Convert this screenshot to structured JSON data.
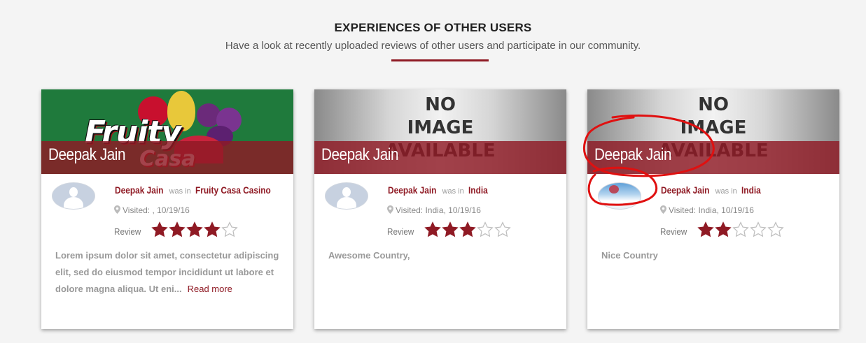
{
  "section": {
    "title": "EXPERIENCES OF OTHER USERS",
    "subtitle": "Have a look at recently uploaded reviews of other users and participate in our community."
  },
  "accent_color": "#8f1a24",
  "cards": [
    {
      "image_type": "fruity-casa-logo",
      "image_text": "Fruity Casa",
      "overlay_name": "Deepak Jain",
      "user_name": "Deepak Jain",
      "was_in": "was in",
      "place": "Fruity Casa Casino",
      "visited": "Visited: , 10/19/16",
      "review_label": "Review",
      "rating": 4,
      "rating_max": 5,
      "description": "Lorem ipsum dolor sit amet, consectetur adipiscing elit, sed do eiusmod tempor incididunt ut labore et dolore magna aliqua. Ut eni...",
      "read_more": "Read more",
      "avatar": "placeholder-person-icon"
    },
    {
      "image_type": "no-image",
      "image_text": "NO\nIMAGE\nAVAILABLE",
      "overlay_name": "Deepak Jain",
      "user_name": "Deepak Jain",
      "was_in": "was in",
      "place": "India",
      "visited": "Visited: India, 10/19/16",
      "review_label": "Review",
      "rating": 3,
      "rating_max": 5,
      "description": "Awesome Country,",
      "avatar": "placeholder-person-icon"
    },
    {
      "image_type": "no-image",
      "image_text": "NO\nIMAGE\nAVAILABLE",
      "overlay_name": "Deepak Jain",
      "user_name": "Deepak Jain",
      "was_in": "was in",
      "place": "India",
      "visited": "Visited: India, 10/19/16",
      "review_label": "Review",
      "rating": 2,
      "rating_max": 5,
      "description": "Nice Country",
      "avatar": "photo-balloon"
    }
  ]
}
